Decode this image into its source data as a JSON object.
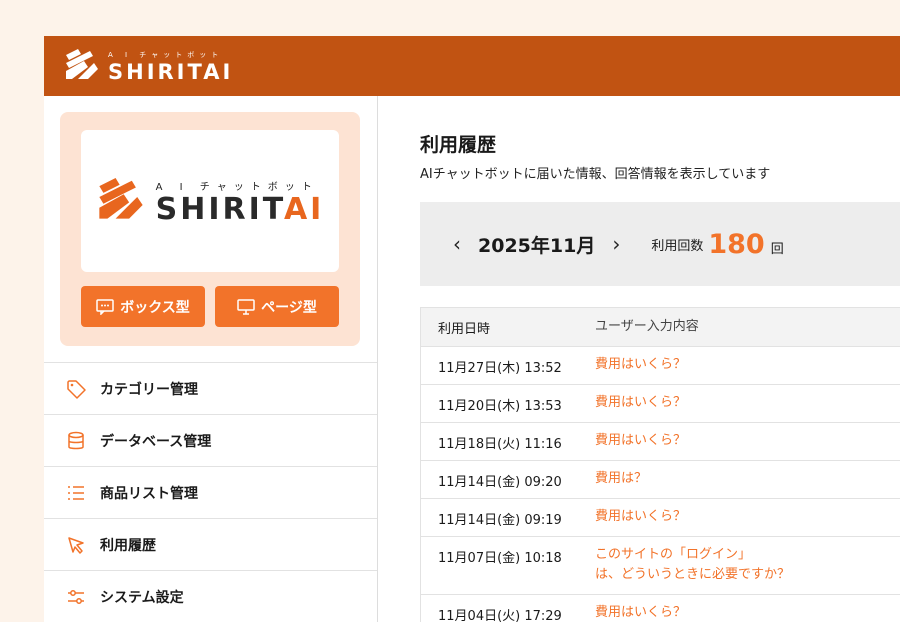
{
  "brand": {
    "tagline": "A I チャットボット",
    "name_prefix": "SHIRIT",
    "name_suffix": "AI",
    "accent_color": "#f2732a",
    "header_color": "#c15312"
  },
  "sidebar": {
    "buttons": [
      {
        "label": "ボックス型",
        "icon": "chat-box-icon"
      },
      {
        "label": "ページ型",
        "icon": "monitor-icon"
      }
    ],
    "items": [
      {
        "label": "カテゴリー管理",
        "icon": "tag-icon"
      },
      {
        "label": "データベース管理",
        "icon": "database-icon"
      },
      {
        "label": "商品リスト管理",
        "icon": "list-icon"
      },
      {
        "label": "利用履歴",
        "icon": "cursor-icon"
      },
      {
        "label": "システム設定",
        "icon": "sliders-icon"
      }
    ]
  },
  "main": {
    "title": "利用履歴",
    "description": "AIチャットボットに届いた情報、回答情報を表示しています",
    "month": "2025年11月",
    "count_label": "利用回数",
    "count_value": "180",
    "count_unit": "回",
    "table": {
      "headers": [
        "利用日時",
        "ユーザー入力内容"
      ],
      "rows": [
        {
          "date": "11月27日(木) 13:52",
          "text": "費用はいくら？"
        },
        {
          "date": "11月20日(木) 13:53",
          "text": "費用はいくら？"
        },
        {
          "date": "11月18日(火) 11:16",
          "text": "費用はいくら？"
        },
        {
          "date": "11月14日(金) 09:20",
          "text": "費用は？"
        },
        {
          "date": "11月14日(金) 09:19",
          "text": "費用はいくら？"
        },
        {
          "date": "11月07日(金) 10:18",
          "text_line1": "このサイトの「ログイン」",
          "text_line2": "は、どういうときに必要ですか？"
        },
        {
          "date": "11月04日(火) 17:29",
          "text": "費用はいくら？"
        }
      ]
    }
  }
}
